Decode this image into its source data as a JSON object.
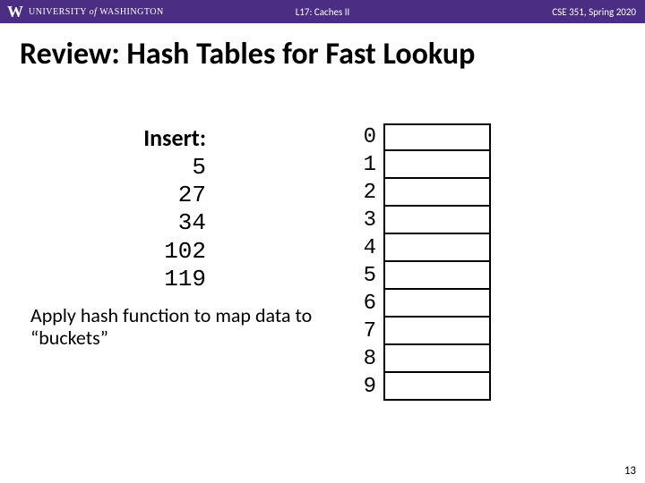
{
  "header": {
    "university": "UNIVERSITY of WASHINGTON",
    "lecture": "L17: Caches II",
    "course": "CSE 351, Spring 2020"
  },
  "title": "Review:  Hash Tables for Fast Lookup",
  "insert": {
    "label": "Insert:",
    "values": [
      "5",
      "27",
      "34",
      "102",
      "119"
    ]
  },
  "caption": "Apply hash function to map data to “buckets”",
  "buckets": [
    "0",
    "1",
    "2",
    "3",
    "4",
    "5",
    "6",
    "7",
    "8",
    "9"
  ],
  "page_number": "13"
}
